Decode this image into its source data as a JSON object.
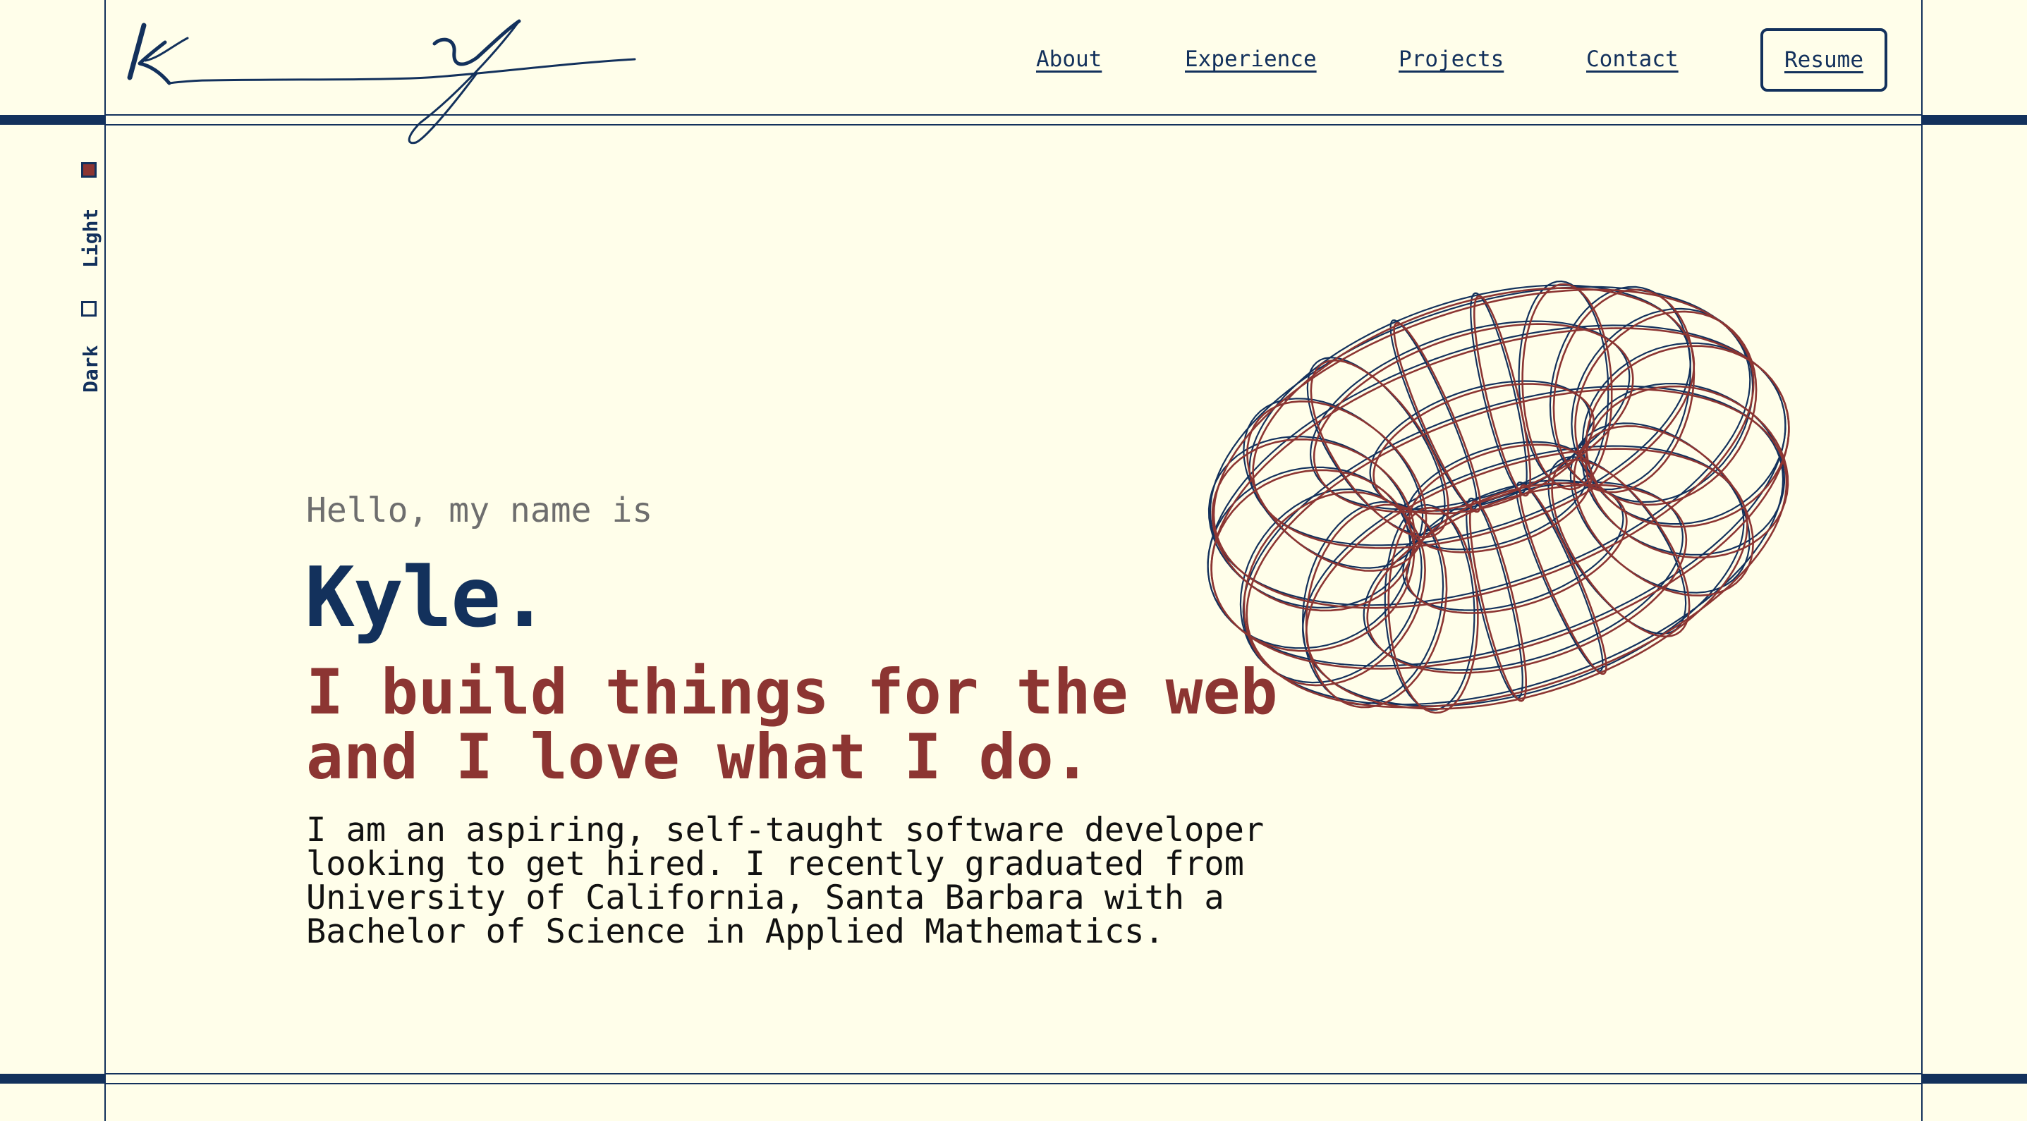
{
  "logo": {
    "text": "KY"
  },
  "nav": {
    "items": [
      {
        "label": "About"
      },
      {
        "label": "Experience"
      },
      {
        "label": "Projects"
      },
      {
        "label": "Contact"
      }
    ],
    "resume_label": "Resume"
  },
  "theme_toggle": {
    "light_label": "Light",
    "dark_label": "Dark",
    "selected": "Light"
  },
  "hero": {
    "greeting": "Hello, my name is",
    "name": "Kyle.",
    "tagline_line1": "I build things for the web",
    "tagline_line2": "and I love what I do.",
    "description_lines": [
      "I am an aspiring, self-taught software developer",
      "looking to get hired. I recently graduated from",
      "University of California, Santa Barbara with a",
      "Bachelor of Science in Applied Mathematics."
    ]
  },
  "colors": {
    "background": "#fffeea",
    "navy": "#13315c",
    "accent_red": "#8c3532",
    "muted_gray": "#6e6e6e"
  },
  "icons": {
    "logo": "signature-logo",
    "hero_art": "wireframe-torus"
  }
}
